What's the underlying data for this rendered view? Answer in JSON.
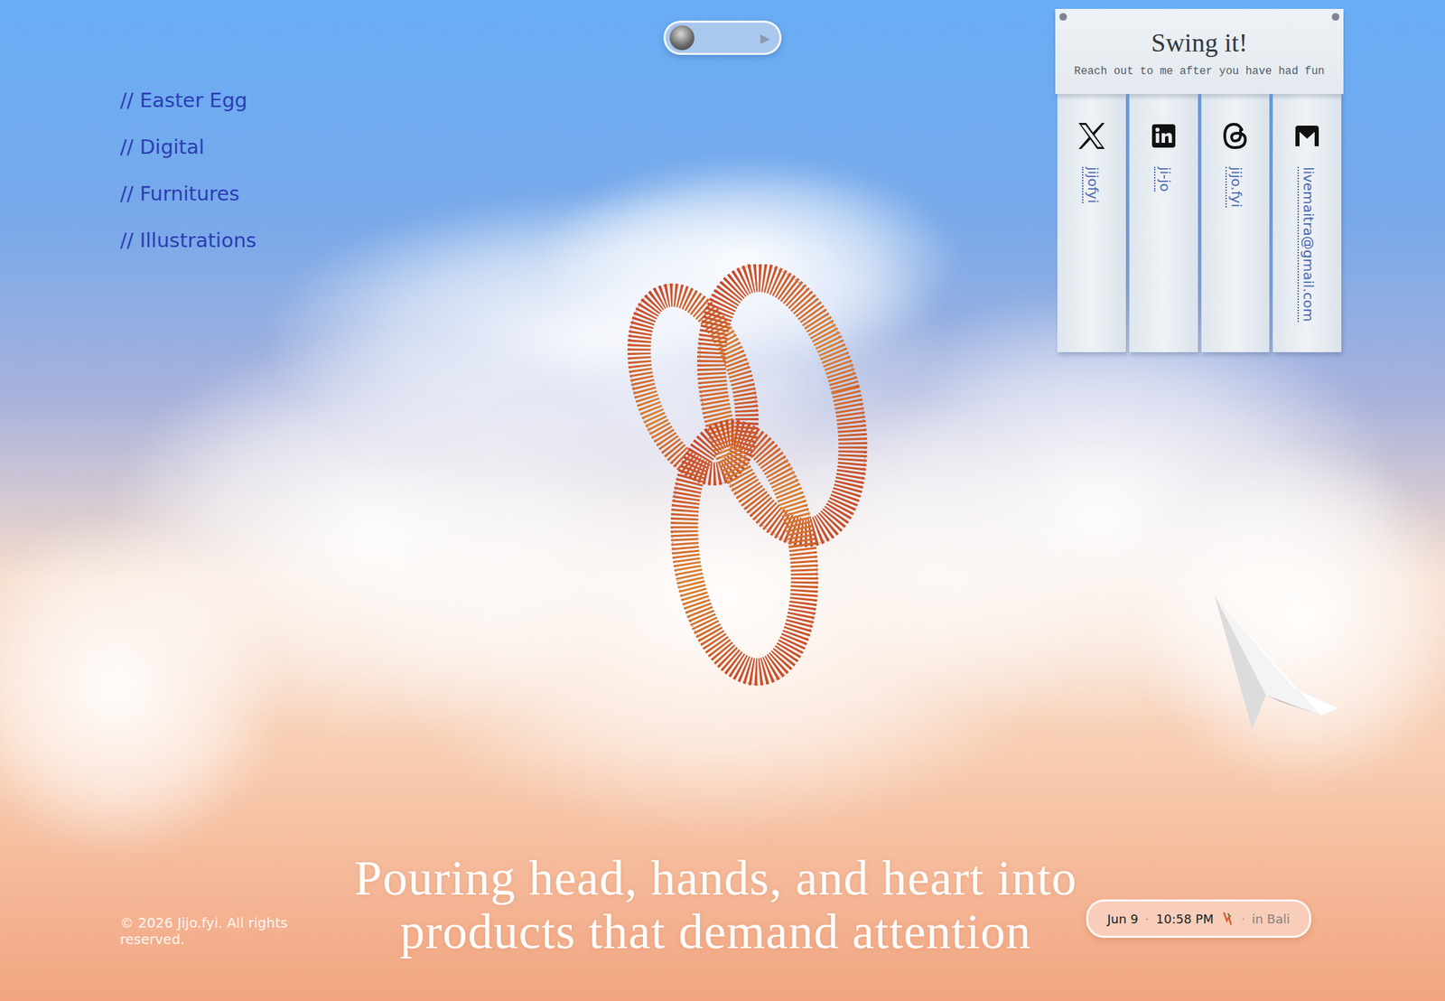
{
  "player": {
    "play": "▶"
  },
  "nav": [
    {
      "label": "// Easter Egg"
    },
    {
      "label": "// Digital"
    },
    {
      "label": "// Furnitures"
    },
    {
      "label": "// Illustrations"
    }
  ],
  "contact": {
    "title": "Swing it!",
    "subtitle": "Reach out to me after you have had fun",
    "links": [
      {
        "kind": "x",
        "handle": "jijofyi"
      },
      {
        "kind": "linkedin",
        "handle": "ji-jo"
      },
      {
        "kind": "threads",
        "handle": "jijo.fyi"
      },
      {
        "kind": "mail",
        "handle": "livemaitra@gmail.com"
      }
    ]
  },
  "headline": [
    "Pouring head, hands, and heart into",
    "products that demand attention"
  ],
  "footer": {
    "copyright": "© 2026 Jijo.fyi.  All rights reserved."
  },
  "status": {
    "date": "Jun 9",
    "separator": "·",
    "time": "10:58 PM",
    "location": "in Bali"
  }
}
